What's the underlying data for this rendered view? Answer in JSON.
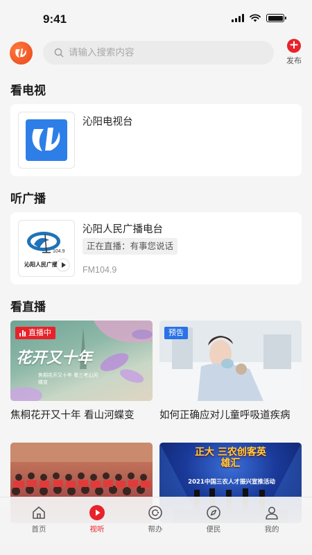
{
  "status_bar": {
    "time": "9:41"
  },
  "header": {
    "search_placeholder": "请输入搜索内容",
    "publish_label": "发布"
  },
  "sections": {
    "tv_title": "看电视",
    "radio_title": "听广播",
    "live_title": "看直播"
  },
  "tv": {
    "name": "沁阳电视台"
  },
  "radio": {
    "name": "沁阳人民广播电台",
    "now_playing": "正在直播：有事您说话",
    "frequency": "FM104.9",
    "logo_freq": "104.9",
    "logo_caption": "沁阳人民广播"
  },
  "live": [
    {
      "caption": "焦桐花开又十年 看山河蝶变",
      "badge": "直播中",
      "image_text": "花开又十年",
      "image_subtext": "焦桐花开又十年 看三考山河蝶变"
    },
    {
      "caption": "如何正确应对儿童呼吸道疾病",
      "badge": "预告"
    },
    {
      "caption": "",
      "badge": ""
    },
    {
      "caption": "",
      "badge": "",
      "image_text": "正大 三农创客英雄汇",
      "image_subtext": "2021中国三农人才振兴宣推活动"
    }
  ],
  "tabs": [
    {
      "label": "首页",
      "icon": "home-icon"
    },
    {
      "label": "视听",
      "icon": "play-icon",
      "active": true
    },
    {
      "label": "帮办",
      "icon": "help-icon"
    },
    {
      "label": "便民",
      "icon": "compass-icon"
    },
    {
      "label": "我的",
      "icon": "user-icon"
    }
  ],
  "colors": {
    "accent": "#e8222a",
    "preview_badge": "#2a72e6",
    "background": "#f5f5f5"
  }
}
